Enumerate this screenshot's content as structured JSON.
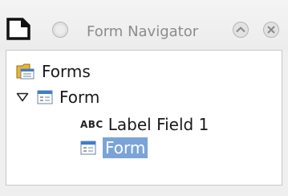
{
  "window": {
    "title": "Form Navigator"
  },
  "tree": {
    "root": {
      "label": "Forms",
      "icon": "forms-folder-icon"
    },
    "form": {
      "label": "Form",
      "expanded": true,
      "icon": "form-icon"
    },
    "label_field": {
      "type_badge": "ABC",
      "label": "Label Field 1"
    },
    "subform": {
      "label": "Form",
      "selected": true,
      "icon": "form-icon"
    }
  },
  "colors": {
    "selection": "#7aa4d7",
    "title_text": "#8c8c8c"
  }
}
